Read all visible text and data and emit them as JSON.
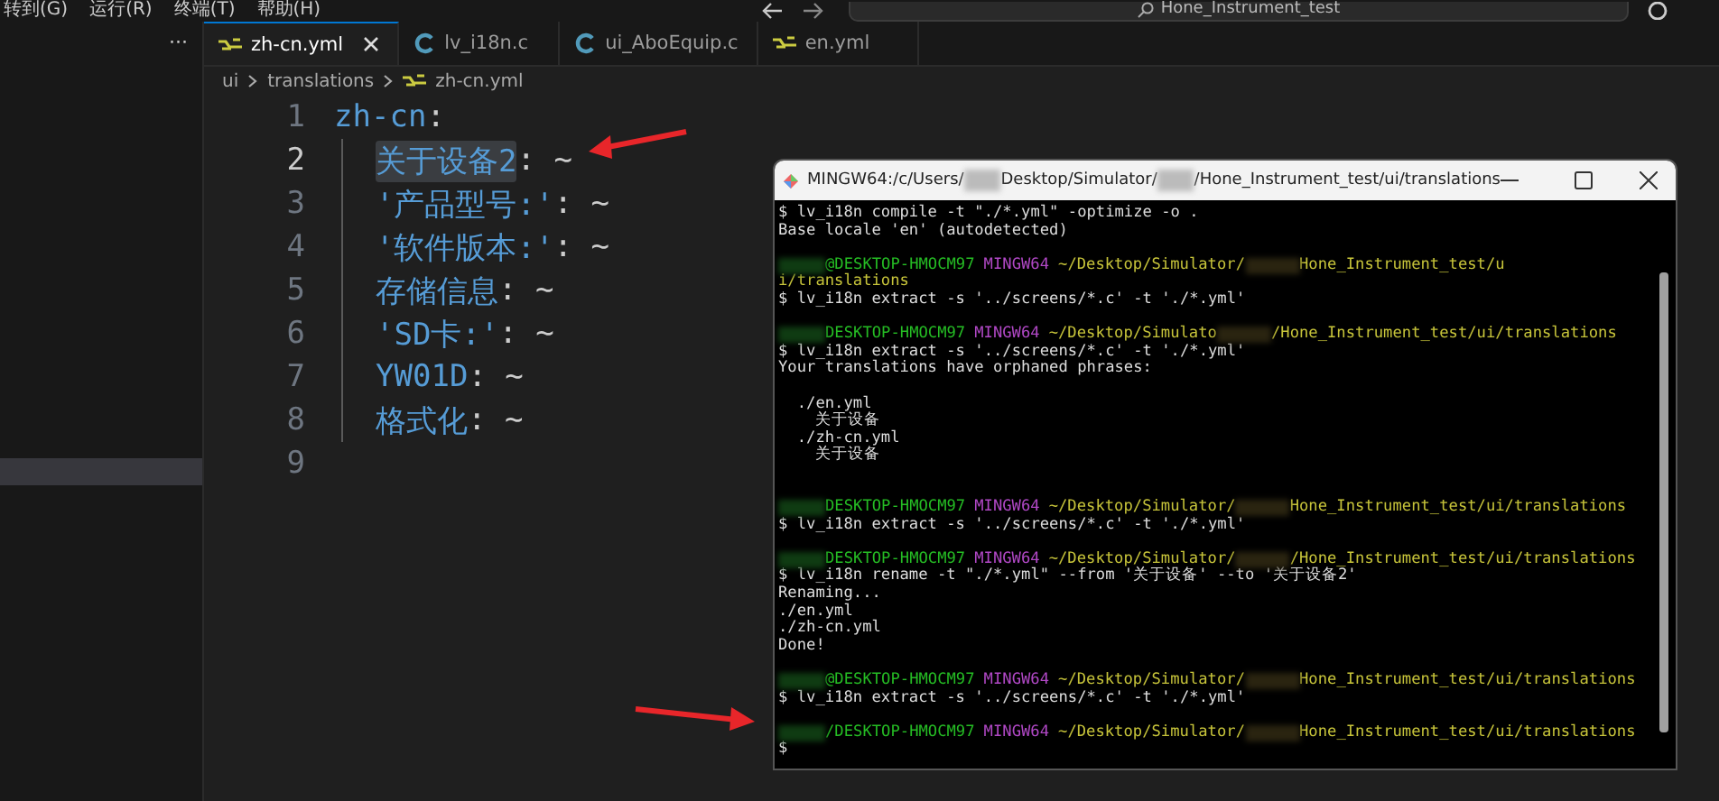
{
  "menu": [
    "转到(G)",
    "运行(R)",
    "终端(T)",
    "帮助(H)"
  ],
  "command_center": {
    "title": "Hone_Instrument_test"
  },
  "sidebar": {
    "more": "···"
  },
  "tabs": [
    {
      "label": "zh-cn.yml",
      "kind": "yaml",
      "selected": true
    },
    {
      "label": "lv_i18n.c",
      "kind": "c",
      "selected": false
    },
    {
      "label": "ui_AboEquip.c",
      "kind": "c",
      "selected": false
    },
    {
      "label": "en.yml",
      "kind": "yaml",
      "selected": false
    }
  ],
  "breadcrumb": [
    {
      "label": "ui",
      "kind": "folder"
    },
    {
      "label": "translations",
      "kind": "folder"
    },
    {
      "label": "zh-cn.yml",
      "kind": "yaml"
    }
  ],
  "code_lines": [
    {
      "number": "1",
      "key": "zh-cn",
      "suffix": ":",
      "current": false,
      "highlighted": false,
      "children": [
        {
          "number": "2",
          "key": "关于设备2",
          "suffix": ": ~",
          "current": true,
          "highlighted": true
        },
        {
          "number": "3",
          "key": "'产品型号:'",
          "suffix": ": ~",
          "current": false,
          "highlighted": false
        },
        {
          "number": "4",
          "key": "'软件版本:'",
          "suffix": ": ~",
          "current": false,
          "highlighted": false
        },
        {
          "number": "5",
          "key": "存储信息",
          "suffix": ": ~",
          "current": false,
          "highlighted": false
        },
        {
          "number": "6",
          "key": "'SD卡:'",
          "suffix": ": ~",
          "current": false,
          "highlighted": false
        },
        {
          "number": "7",
          "key": "YW01D",
          "suffix": ": ~",
          "current": false,
          "highlighted": false
        },
        {
          "number": "8",
          "key": "格式化",
          "suffix": ": ~",
          "current": false,
          "highlighted": false
        }
      ]
    },
    {
      "number": "9",
      "current": false
    }
  ],
  "terminal": {
    "title_parts": [
      "MINGW64:/c/Users/",
      "Desktop/Simulator/",
      "/Hone_Instrument_test/ui/translations"
    ],
    "lines": [
      {
        "kind": "out",
        "text": "$ lv_i18n compile -t \"./*.yml\" -optimize -o ."
      },
      {
        "kind": "out",
        "text": "Base locale 'en' (autodetected)"
      },
      {
        "kind": "blank"
      },
      {
        "kind": "prompt",
        "host": "@DESKTOP-HMOCM97",
        "shell": "MINGW64",
        "path": "~/Desktop/Simulator/",
        "path_rest": "Hone_Instrument_test/u"
      },
      {
        "kind": "cont",
        "text": "i/translations"
      },
      {
        "kind": "out",
        "text": "$ lv_i18n extract -s '../screens/*.c' -t './*.yml'"
      },
      {
        "kind": "blank"
      },
      {
        "kind": "prompt",
        "host": "DESKTOP-HMOCM97",
        "shell": "MINGW64",
        "path": "~/Desktop/Simulato",
        "path_rest": "/Hone_Instrument_test/ui/translations"
      },
      {
        "kind": "out",
        "text": "$ lv_i18n extract -s '../screens/*.c' -t './*.yml'"
      },
      {
        "kind": "out",
        "text": "Your translations have orphaned phrases:"
      },
      {
        "kind": "blank"
      },
      {
        "kind": "out",
        "text": "  ./en.yml"
      },
      {
        "kind": "out",
        "text": "    关于设备"
      },
      {
        "kind": "out",
        "text": "  ./zh-cn.yml"
      },
      {
        "kind": "out",
        "text": "    关于设备"
      },
      {
        "kind": "blank"
      },
      {
        "kind": "blank"
      },
      {
        "kind": "prompt",
        "host": "DESKTOP-HMOCM97",
        "shell": "MINGW64",
        "path": "~/Desktop/Simulator/",
        "path_rest": "Hone_Instrument_test/ui/translations"
      },
      {
        "kind": "out",
        "text": "$ lv_i18n extract -s '../screens/*.c' -t './*.yml'"
      },
      {
        "kind": "blank"
      },
      {
        "kind": "prompt",
        "host": "DESKTOP-HMOCM97",
        "shell": "MINGW64",
        "path": "~/Desktop/Simulator/",
        "path_rest": "/Hone_Instrument_test/ui/translations"
      },
      {
        "kind": "out",
        "text": "$ lv_i18n rename -t \"./*.yml\" --from '关于设备' --to '关于设备2'"
      },
      {
        "kind": "out",
        "text": "Renaming..."
      },
      {
        "kind": "out",
        "text": "./en.yml"
      },
      {
        "kind": "out",
        "text": "./zh-cn.yml"
      },
      {
        "kind": "out",
        "text": "Done!"
      },
      {
        "kind": "blank"
      },
      {
        "kind": "prompt",
        "host": "@DESKTOP-HMOCM97",
        "shell": "MINGW64",
        "path": "~/Desktop/Simulator/",
        "path_rest": "Hone_Instrument_test/ui/translations"
      },
      {
        "kind": "out",
        "text": "$ lv_i18n extract -s '../screens/*.c' -t './*.yml'"
      },
      {
        "kind": "blank"
      },
      {
        "kind": "prompt",
        "host": "/DESKTOP-HMOCM97",
        "shell": "MINGW64",
        "path": "~/Desktop/Simulator/",
        "path_rest": "Hone_Instrument_test/ui/translations"
      },
      {
        "kind": "out",
        "text": "$"
      }
    ]
  }
}
